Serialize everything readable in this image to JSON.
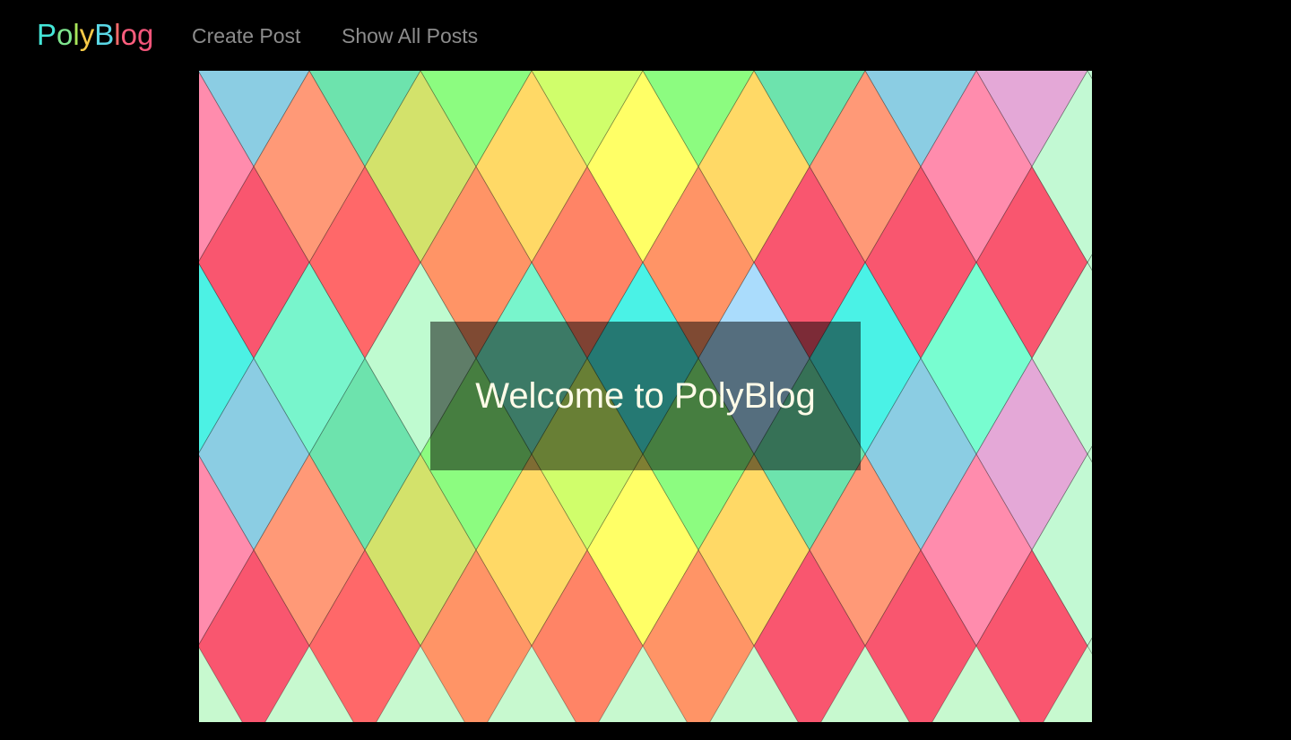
{
  "navbar": {
    "brand": {
      "letters": [
        {
          "char": "P",
          "color": "#44e6d8"
        },
        {
          "char": "o",
          "color": "#7fe68f"
        },
        {
          "char": "l",
          "color": "#a8e65a"
        },
        {
          "char": "y",
          "color": "#f7c948"
        },
        {
          "char": "B",
          "color": "#5ad8e6"
        },
        {
          "char": "l",
          "color": "#ff6b6b"
        },
        {
          "char": "o",
          "color": "#ff5e7e"
        },
        {
          "char": "g",
          "color": "#f2557a"
        }
      ]
    },
    "links": [
      {
        "label": "Create Post"
      },
      {
        "label": "Show All Posts"
      }
    ]
  },
  "hero": {
    "welcome_text": "Welcome to PolyBlog",
    "background_pattern": {
      "name": "harlequin-diamonds",
      "colors": [
        [
          "#4cf1e4",
          "#78f5cc",
          "#bffbd0",
          "#8cfc80",
          "#d0fe6b",
          "#4af2e6",
          "#aadcfc",
          "#4af2e6",
          "#78fdd0",
          "#c2f9d3"
        ],
        [
          "#8bcde3",
          "#6de3ad",
          "#8cfc80",
          "#d0fe6b",
          "#8cfc80",
          "#6de3ad",
          "#8bcde3",
          "#e4a8d7",
          "#c2f9d3"
        ],
        [
          "#ff8cad",
          "#ff9977",
          "#d3e26b",
          "#ffd966",
          "#ffff66",
          "#ffd966",
          "#ff9977",
          "#ff8cad",
          "#c2f9d3"
        ],
        [
          "#f9566f",
          "#ff6869",
          "#ff9466",
          "#ff8466",
          "#ff9466",
          "#f9566f",
          "#f9566f",
          "#f9566f",
          "#c2f9d3"
        ],
        [
          "#4cf1e4",
          "#78f5cc",
          "#bffbd0",
          "#78f5cc",
          "#4af2e6",
          "#aadcfc",
          "#4af2e6",
          "#78fdd0",
          "#c2f9d3"
        ],
        [
          "#8bcde3",
          "#6de3ad",
          "#8cfc80",
          "#d0fe6b",
          "#8cfc80",
          "#6de3ad",
          "#8bcde3",
          "#e4a8d7",
          "#c2f9d3"
        ],
        [
          "#ff8cad",
          "#ff9977",
          "#d3e26b",
          "#ffd966",
          "#ffff66",
          "#ffd966",
          "#ff9977",
          "#ff8cad",
          "#c2f9d3"
        ],
        [
          "#f9566f",
          "#ff6869",
          "#ff9466",
          "#ff8466",
          "#ff9466",
          "#f9566f",
          "#f9566f",
          "#f9566f",
          "#c2f9d3"
        ]
      ]
    }
  }
}
